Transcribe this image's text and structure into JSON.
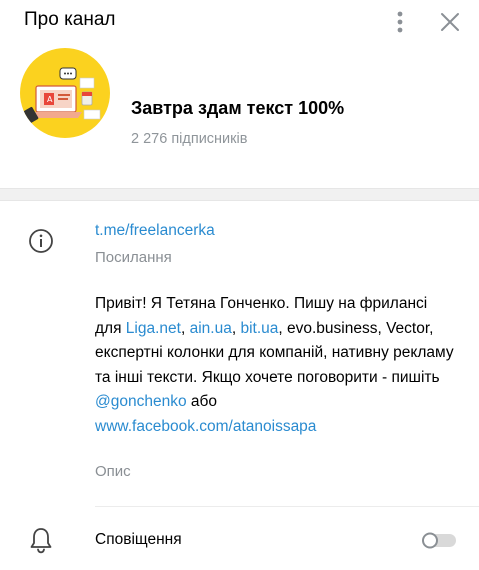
{
  "header": {
    "title": "Про канал",
    "menu_icon": "more-vertical-icon",
    "close_icon": "close-icon"
  },
  "channel": {
    "name": "Завтра здам текст 100%",
    "subscribers": "2 276 підписників",
    "avatar_color": "#fbd21f"
  },
  "link": {
    "url": "t.me/freelancerka",
    "caption": "Посилання"
  },
  "description": {
    "t1": "Привіт! Я Тетяна Гонченко. Пишу на фрилансі для ",
    "l1": "Liga.net",
    "t2": ", ",
    "l2": "ain.ua",
    "t3": ", ",
    "l3": "bit.ua",
    "t4": ", evo.business, Vector, експертні колонки для компаній, нативну рекламу та інші тексти. Якщо хочете поговорити - пишіть ",
    "l4": "@gonchenko",
    "t5": " або ",
    "l5": "www.facebook.com/atanoissapa",
    "caption": "Опис"
  },
  "notifications": {
    "label": "Сповіщення",
    "enabled": false
  },
  "colors": {
    "link": "#2a8bd0",
    "secondary_text": "#8a8f94"
  }
}
